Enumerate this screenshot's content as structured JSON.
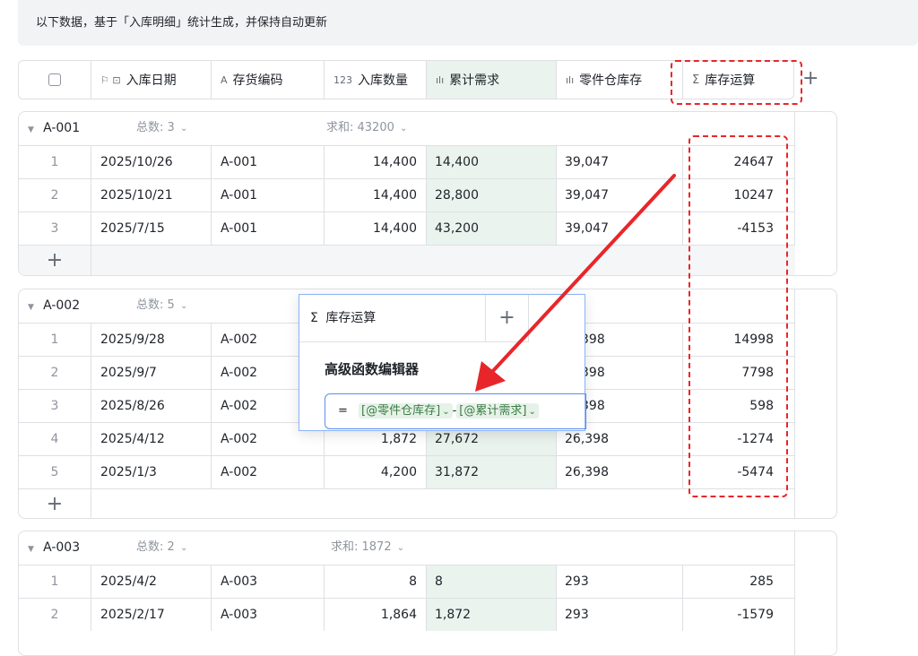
{
  "banner": "以下数据，基于「入库明细」统计生成，并保持自动更新",
  "columns": {
    "date": "入库日期",
    "code": "存货编码",
    "qty": "入库数量",
    "cum": "累计需求",
    "stock": "零件仓库存",
    "calc": "库存运算",
    "date_icon": "⚐ ⊡",
    "code_icon": "A",
    "qty_icon": "123",
    "cum_icon": "ılı",
    "stock_icon": "ılı",
    "calc_icon": "Σ"
  },
  "add_symbol": "+",
  "groups": [
    {
      "name": "A-001",
      "count_label": "总数: 3",
      "sum_label": "求和: 43200",
      "rows": [
        {
          "n": "1",
          "date": "2025/10/26",
          "code": "A-001",
          "qty": "14,400",
          "cum": "14,400",
          "stock": "39,047",
          "calc": "24647"
        },
        {
          "n": "2",
          "date": "2025/10/21",
          "code": "A-001",
          "qty": "14,400",
          "cum": "28,800",
          "stock": "39,047",
          "calc": "10247"
        },
        {
          "n": "3",
          "date": "2025/7/15",
          "code": "A-001",
          "qty": "14,400",
          "cum": "43,200",
          "stock": "39,047",
          "calc": "-4153"
        }
      ]
    },
    {
      "name": "A-002",
      "count_label": "总数: 5",
      "sum_label": "",
      "rows": [
        {
          "n": "1",
          "date": "2025/9/28",
          "code": "A-002",
          "qty": "",
          "cum": "",
          "stock": "398",
          "calc": "14998"
        },
        {
          "n": "2",
          "date": "2025/9/7",
          "code": "A-002",
          "qty": "",
          "cum": "",
          "stock": "398",
          "calc": "7798"
        },
        {
          "n": "3",
          "date": "2025/8/26",
          "code": "A-002",
          "qty": "",
          "cum": "",
          "stock": "398",
          "calc": "598"
        },
        {
          "n": "4",
          "date": "2025/4/12",
          "code": "A-002",
          "qty": "1,872",
          "cum": "27,672",
          "stock": "26,398",
          "calc": "-1274"
        },
        {
          "n": "5",
          "date": "2025/1/3",
          "code": "A-002",
          "qty": "4,200",
          "cum": "31,872",
          "stock": "26,398",
          "calc": "-5474"
        }
      ]
    },
    {
      "name": "A-003",
      "count_label": "总数: 2",
      "sum_label": "求和: 1872",
      "rows": [
        {
          "n": "1",
          "date": "2025/4/2",
          "code": "A-003",
          "qty": "8",
          "cum": "8",
          "stock": "293",
          "calc": "285"
        },
        {
          "n": "2",
          "date": "2025/2/17",
          "code": "A-003",
          "qty": "1,864",
          "cum": "1,872",
          "stock": "293",
          "calc": "-1579"
        }
      ]
    }
  ],
  "popup": {
    "title": "库存运算",
    "title_icon": "Σ",
    "heading": "高级函数编辑器",
    "formula_prefix": "=",
    "formula_ref1": "[@零件仓库存]",
    "formula_op": "-",
    "formula_ref2": "[@累计需求]"
  },
  "colors": {
    "highlight": "#e8262a",
    "selected_column": "#ebf3ee",
    "formula_border": "#5b8def"
  }
}
